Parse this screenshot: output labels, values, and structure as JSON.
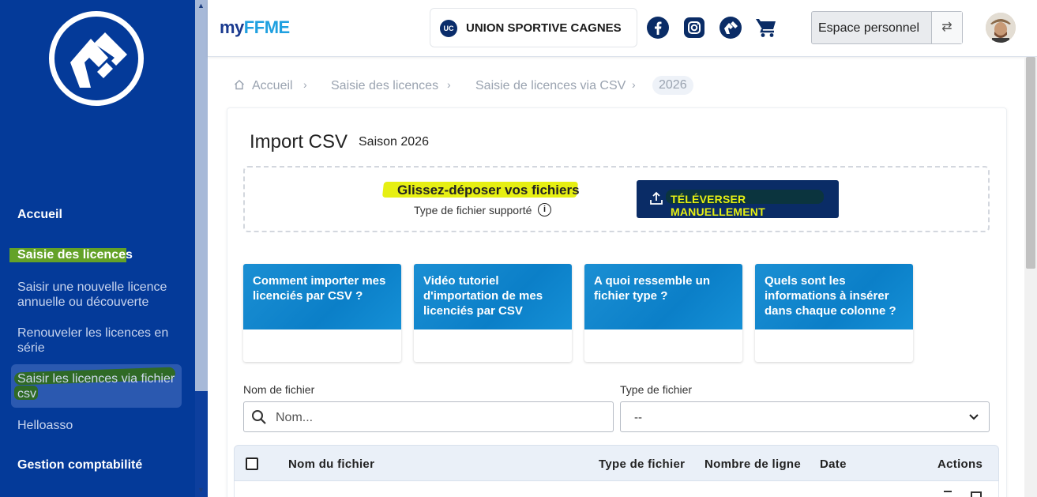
{
  "sidebar": {
    "nav": [
      {
        "label": "Accueil"
      },
      {
        "label": "Saisie des licences"
      },
      {
        "label": "Saisir une nouvelle licence annuelle ou découverte"
      },
      {
        "label": "Renouveler les licences en série"
      },
      {
        "label": "Saisir les licences via fichier csv"
      },
      {
        "label": "Helloasso"
      },
      {
        "label": "Gestion comptabilité"
      }
    ]
  },
  "header": {
    "brand_my": "my",
    "brand_ff": "FF",
    "brand_me": "ME",
    "club_badge": "UC",
    "club_name": "UNION SPORTIVE CAGNES",
    "espace_label": "Espace personnel",
    "swap_glyph": "⇄"
  },
  "breadcrumb": {
    "items": [
      "Accueil",
      "Saisie des licences",
      "Saisie de licences via CSV"
    ],
    "current": "2026"
  },
  "page": {
    "title": "Import CSV",
    "season": "Saison 2026"
  },
  "dropzone": {
    "title": "Glissez-déposer vos fichiers",
    "subtitle": "Type de fichier supporté",
    "info_glyph": "i",
    "upload_label": "TÉLÉVERSER MANUELLEMENT"
  },
  "help_cards": [
    {
      "text": "Comment importer mes licenciés par CSV ?"
    },
    {
      "text": "Vidéo tutoriel d'importation de mes licenciés par CSV"
    },
    {
      "text": "A quoi ressemble un fichier type ?"
    },
    {
      "text": "Quels sont les informations à insérer dans chaque colonne ?"
    }
  ],
  "filters": {
    "filename_label": "Nom de fichier",
    "filename_placeholder": "Nom...",
    "filetype_label": "Type de fichier",
    "filetype_value": "--"
  },
  "table": {
    "columns": [
      "Nom du fichier",
      "Type de fichier",
      "Nombre de ligne",
      "Date",
      "Actions"
    ]
  },
  "colors": {
    "sidebar": "#043a99",
    "primary": "#0a2c66",
    "accent": "#1fa0e0",
    "highlight": "#e6ef13"
  },
  "icons": [
    "facebook-icon",
    "instagram-icon",
    "ffme-icon",
    "cart-icon",
    "home-icon",
    "search-icon",
    "upload-icon",
    "info-icon",
    "chevron-down-icon",
    "swap-icon"
  ]
}
